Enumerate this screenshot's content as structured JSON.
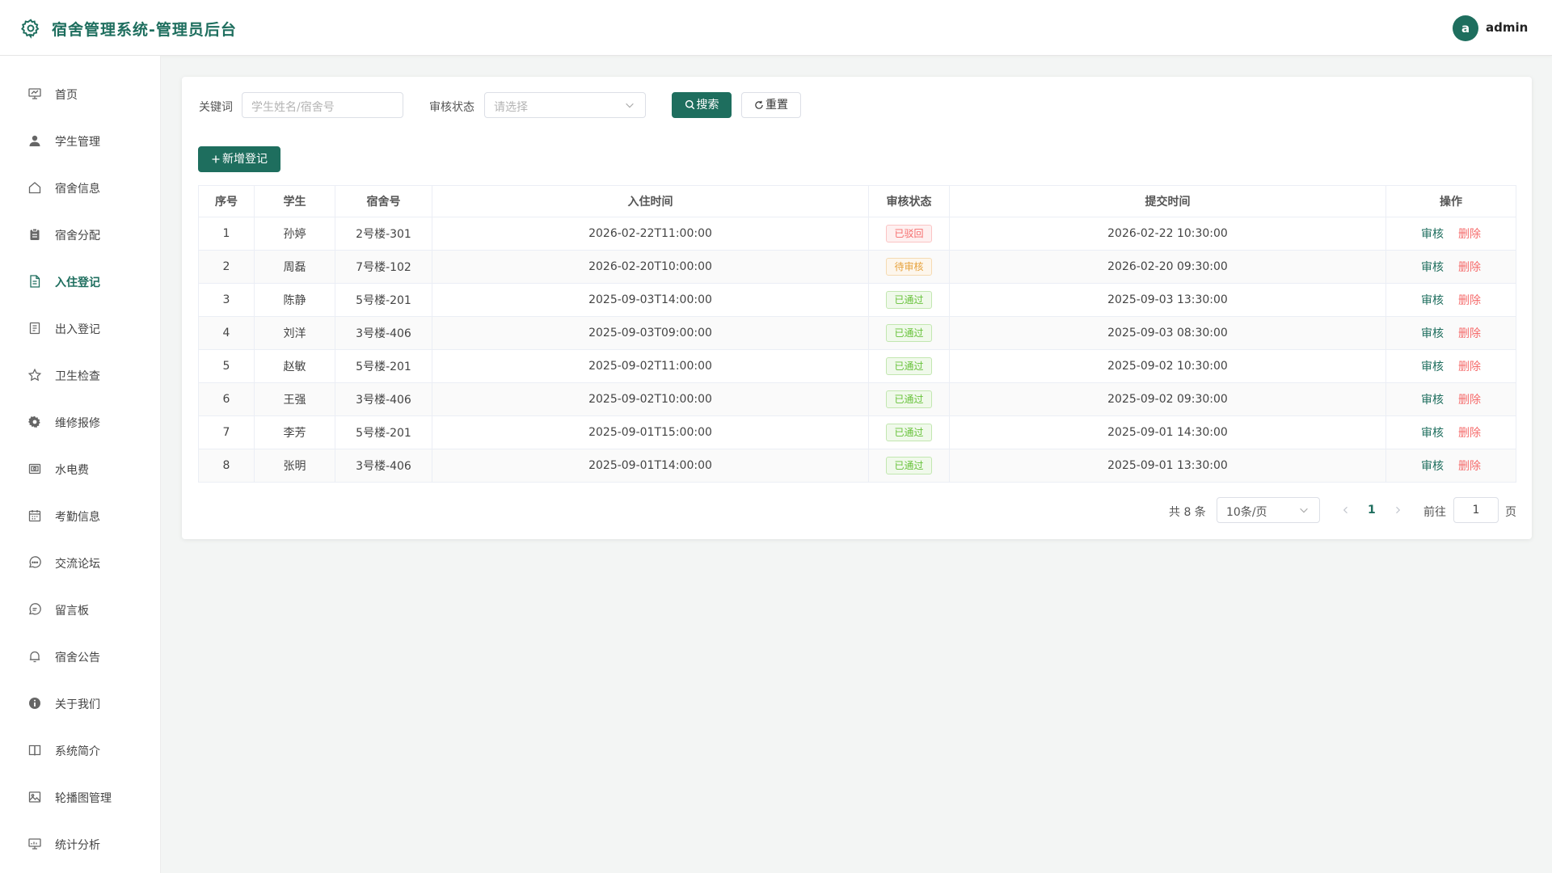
{
  "header": {
    "title": "宿舍管理系统-管理员后台",
    "avatar_letter": "a",
    "username": "admin",
    "brand_color": "#1e6e5e"
  },
  "sidebar": {
    "active_index": 4,
    "items": [
      {
        "label": "首页",
        "icon": "presentation-board-icon"
      },
      {
        "label": "学生管理",
        "icon": "user-icon"
      },
      {
        "label": "宿舍信息",
        "icon": "home-icon"
      },
      {
        "label": "宿舍分配",
        "icon": "clipboard-icon"
      },
      {
        "label": "入住登记",
        "icon": "document-icon"
      },
      {
        "label": "出入登记",
        "icon": "tickets-icon"
      },
      {
        "label": "卫生检查",
        "icon": "star-icon"
      },
      {
        "label": "维修报修",
        "icon": "gear-icon"
      },
      {
        "label": "水电费",
        "icon": "wallet-icon"
      },
      {
        "label": "考勤信息",
        "icon": "calendar-icon"
      },
      {
        "label": "交流论坛",
        "icon": "chat-dots-icon"
      },
      {
        "label": "留言板",
        "icon": "chat-lines-icon"
      },
      {
        "label": "宿舍公告",
        "icon": "bell-icon"
      },
      {
        "label": "关于我们",
        "icon": "info-icon"
      },
      {
        "label": "系统简介",
        "icon": "book-icon"
      },
      {
        "label": "轮播图管理",
        "icon": "picture-icon"
      },
      {
        "label": "统计分析",
        "icon": "data-board-icon"
      }
    ]
  },
  "filters": {
    "keyword_label": "关键词",
    "keyword_placeholder": "学生姓名/宿舍号",
    "status_label": "审核状态",
    "status_placeholder": "请选择",
    "search_label": "搜索",
    "reset_label": "重置",
    "add_label": "新增登记"
  },
  "table": {
    "columns": [
      "序号",
      "学生",
      "宿舍号",
      "入住时间",
      "审核状态",
      "提交时间",
      "操作"
    ],
    "review_label": "审核",
    "delete_label": "删除",
    "rows": [
      {
        "no": "1",
        "student": "孙婷",
        "room": "2号楼-301",
        "checkin": "2026-02-22T11:00:00",
        "status": "已驳回",
        "status_type": "rejected",
        "submitted": "2026-02-22 10:30:00"
      },
      {
        "no": "2",
        "student": "周磊",
        "room": "7号楼-102",
        "checkin": "2026-02-20T10:00:00",
        "status": "待审核",
        "status_type": "pending",
        "submitted": "2026-02-20 09:30:00"
      },
      {
        "no": "3",
        "student": "陈静",
        "room": "5号楼-201",
        "checkin": "2025-09-03T14:00:00",
        "status": "已通过",
        "status_type": "passed",
        "submitted": "2025-09-03 13:30:00"
      },
      {
        "no": "4",
        "student": "刘洋",
        "room": "3号楼-406",
        "checkin": "2025-09-03T09:00:00",
        "status": "已通过",
        "status_type": "passed",
        "submitted": "2025-09-03 08:30:00"
      },
      {
        "no": "5",
        "student": "赵敏",
        "room": "5号楼-201",
        "checkin": "2025-09-02T11:00:00",
        "status": "已通过",
        "status_type": "passed",
        "submitted": "2025-09-02 10:30:00"
      },
      {
        "no": "6",
        "student": "王强",
        "room": "3号楼-406",
        "checkin": "2025-09-02T10:00:00",
        "status": "已通过",
        "status_type": "passed",
        "submitted": "2025-09-02 09:30:00"
      },
      {
        "no": "7",
        "student": "李芳",
        "room": "5号楼-201",
        "checkin": "2025-09-01T15:00:00",
        "status": "已通过",
        "status_type": "passed",
        "submitted": "2025-09-01 14:30:00"
      },
      {
        "no": "8",
        "student": "张明",
        "room": "3号楼-406",
        "checkin": "2025-09-01T14:00:00",
        "status": "已通过",
        "status_type": "passed",
        "submitted": "2025-09-01 13:30:00"
      }
    ]
  },
  "pagination": {
    "total_text": "共 8 条",
    "page_size": "10条/页",
    "current_page": "1",
    "goto_label": "前往",
    "goto_value": "1",
    "page_suffix": "页"
  }
}
